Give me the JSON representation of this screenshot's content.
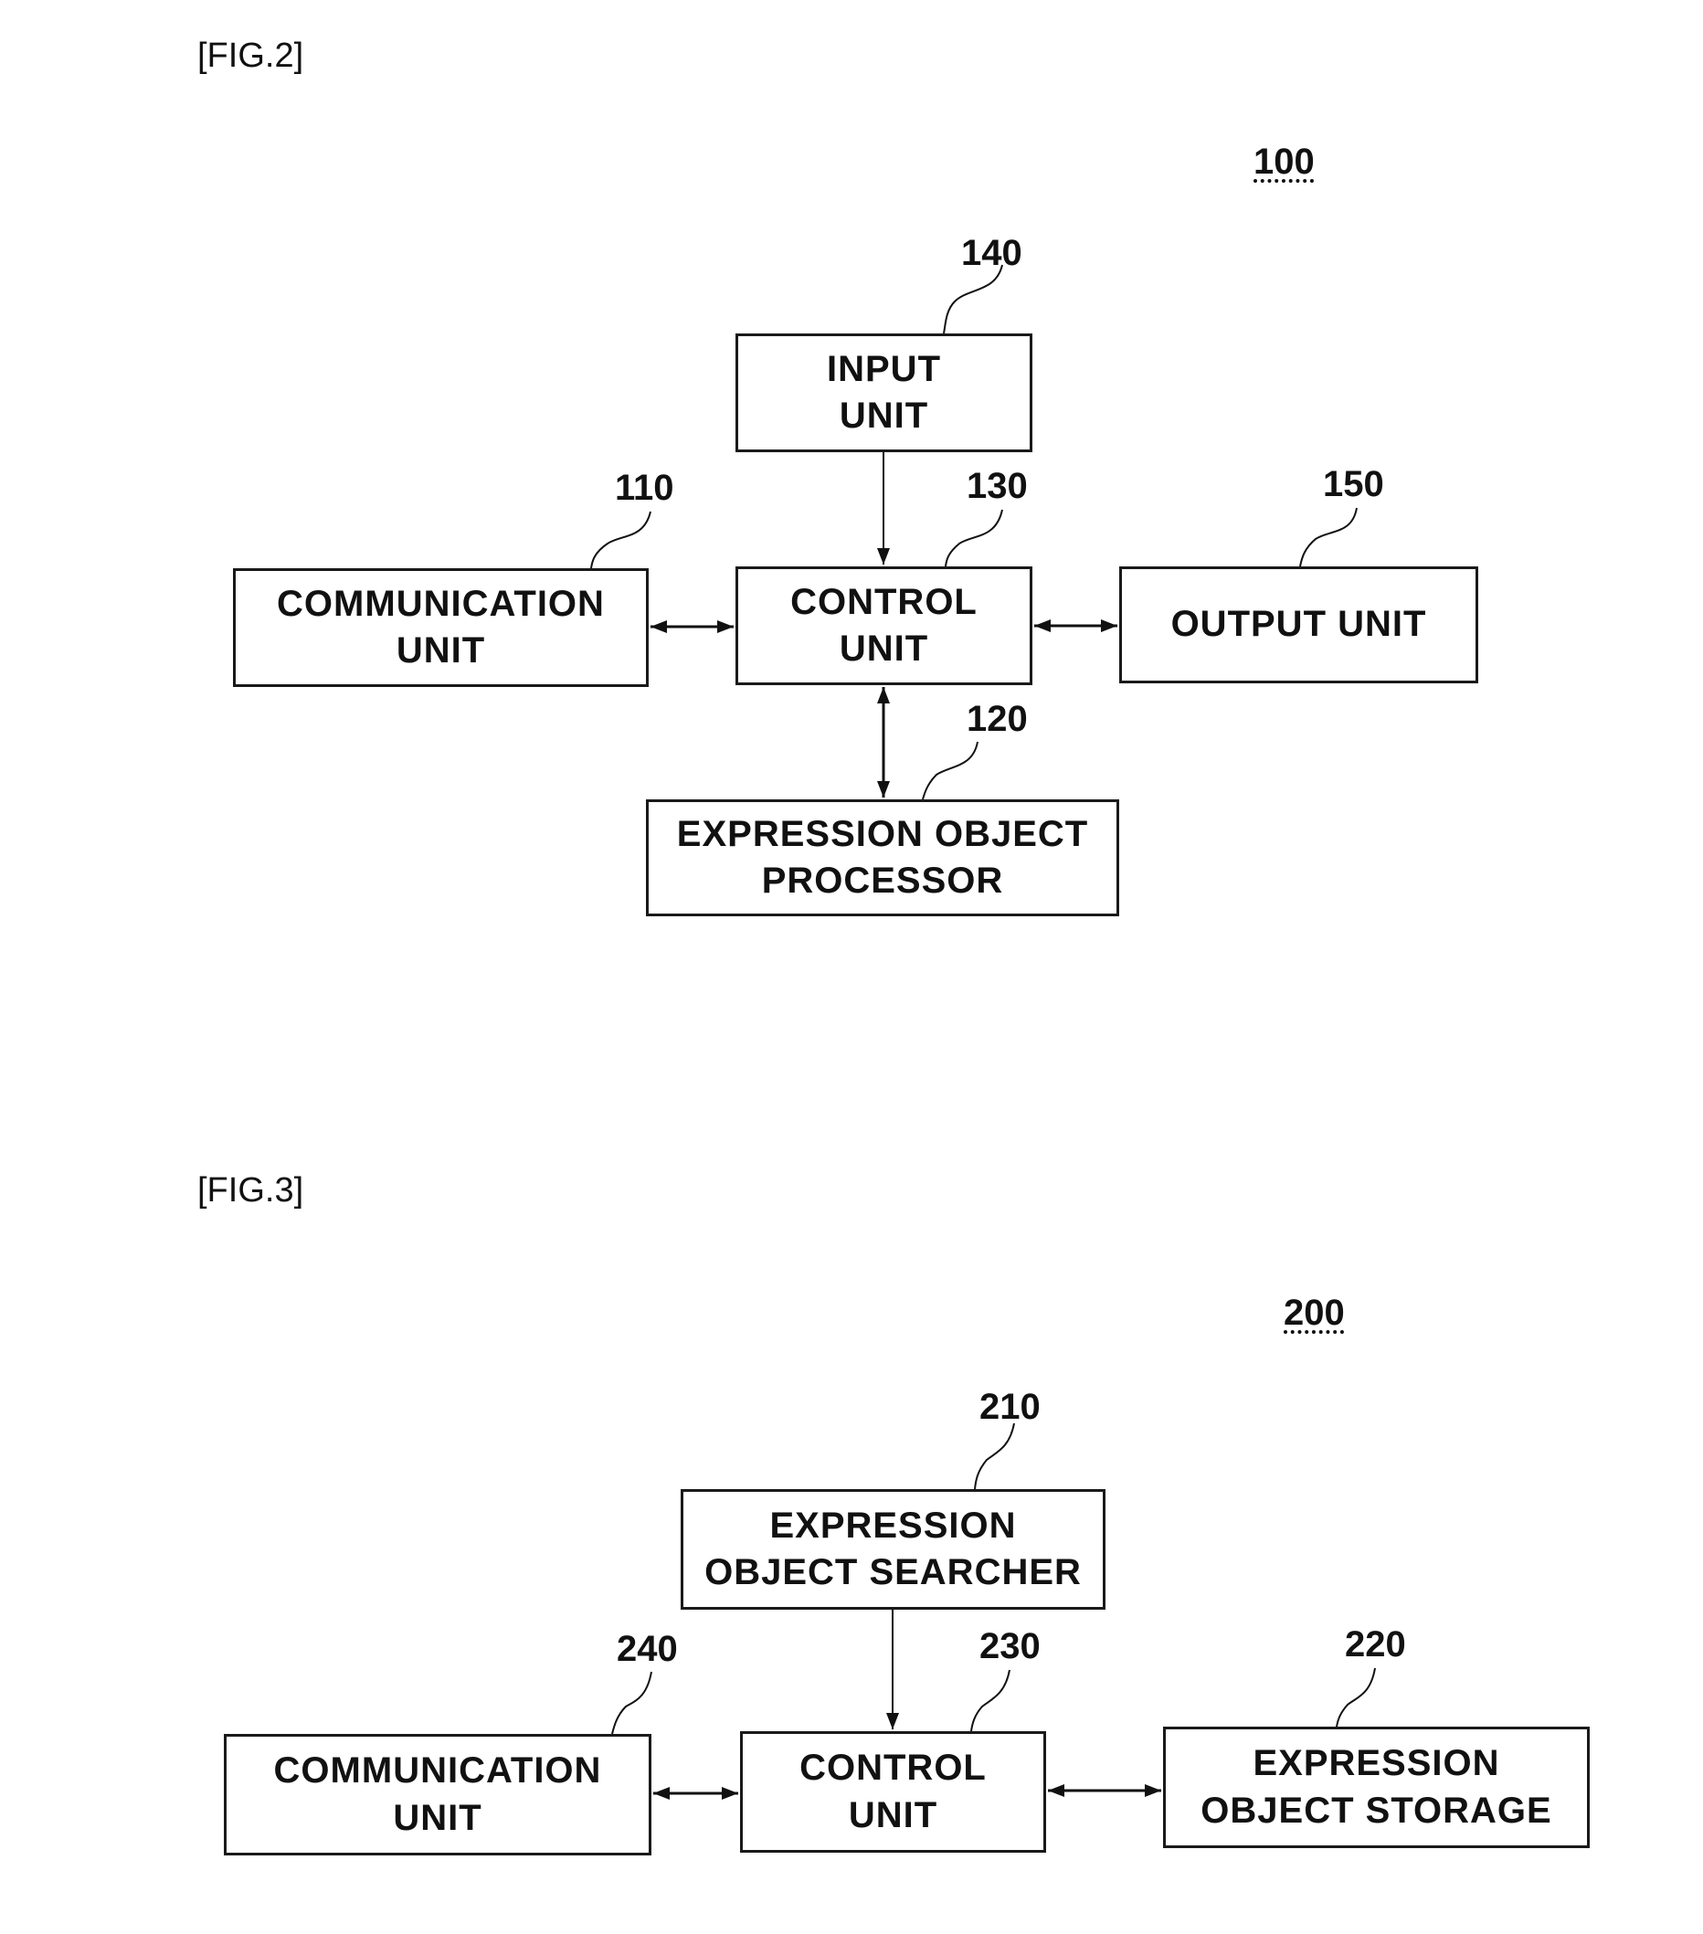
{
  "figures": [
    {
      "label": "[FIG.2]",
      "system_ref": "100",
      "blocks": [
        {
          "id": "input",
          "ref": "140",
          "text": "INPUT\nUNIT"
        },
        {
          "id": "communication",
          "ref": "110",
          "text": "COMMUNICATION\nUNIT"
        },
        {
          "id": "control",
          "ref": "130",
          "text": "CONTROL\nUNIT"
        },
        {
          "id": "output",
          "ref": "150",
          "text": "OUTPUT UNIT"
        },
        {
          "id": "processor",
          "ref": "120",
          "text": "EXPRESSION OBJECT\nPROCESSOR"
        }
      ],
      "connections": [
        {
          "from": "input",
          "to": "control",
          "direction": "one-way"
        },
        {
          "from": "communication",
          "to": "control",
          "direction": "two-way"
        },
        {
          "from": "control",
          "to": "output",
          "direction": "two-way"
        },
        {
          "from": "control",
          "to": "processor",
          "direction": "two-way"
        }
      ]
    },
    {
      "label": "[FIG.3]",
      "system_ref": "200",
      "blocks": [
        {
          "id": "searcher",
          "ref": "210",
          "text": "EXPRESSION\nOBJECT SEARCHER"
        },
        {
          "id": "communication",
          "ref": "240",
          "text": "COMMUNICATION\nUNIT"
        },
        {
          "id": "control",
          "ref": "230",
          "text": "CONTROL\nUNIT"
        },
        {
          "id": "storage",
          "ref": "220",
          "text": "EXPRESSION\nOBJECT STORAGE"
        }
      ],
      "connections": [
        {
          "from": "searcher",
          "to": "control",
          "direction": "one-way"
        },
        {
          "from": "communication",
          "to": "control",
          "direction": "two-way"
        },
        {
          "from": "control",
          "to": "storage",
          "direction": "two-way"
        }
      ]
    }
  ]
}
